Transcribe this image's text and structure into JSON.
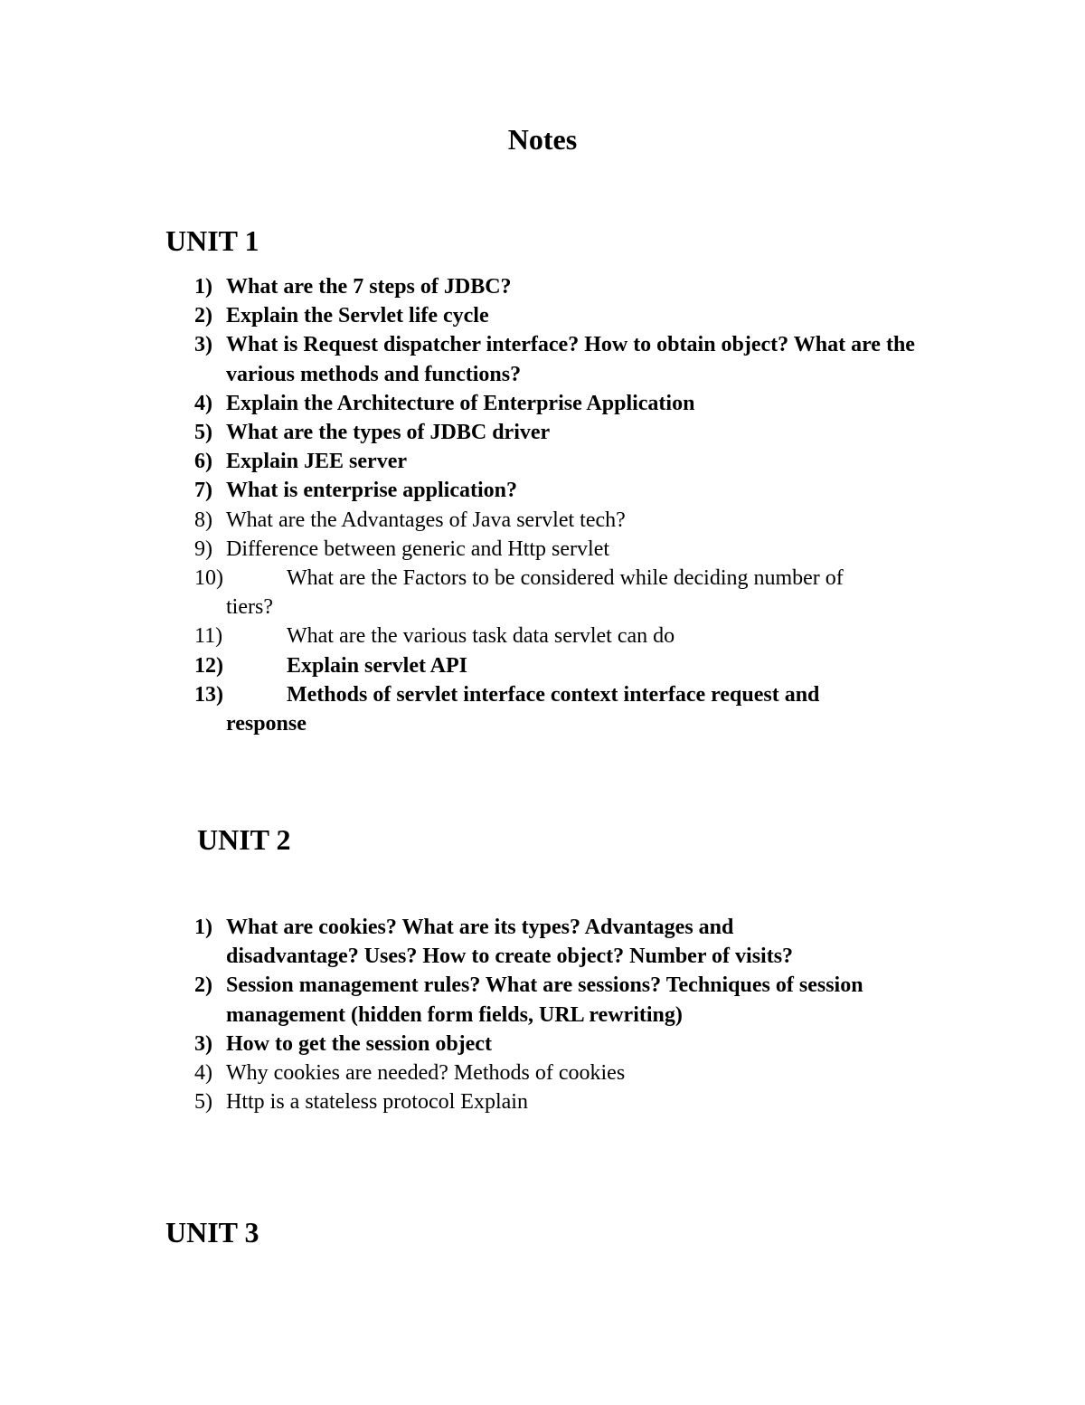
{
  "title": "Notes",
  "units": [
    {
      "heading": "UNIT 1",
      "items": [
        {
          "num": "1)",
          "text": "What are the 7 steps of JDBC?",
          "bold": true
        },
        {
          "num": "2)",
          "text": "Explain the Servlet life cycle",
          "bold": true
        },
        {
          "num": "3)",
          "text": "What is Request dispatcher interface? How to obtain object? What are the various methods and functions?",
          "bold": true
        },
        {
          "num": "4)",
          "text": "Explain the Architecture of Enterprise Application",
          "bold": true
        },
        {
          "num": "5)",
          "text": " What are the types of JDBC driver",
          "bold": true
        },
        {
          "num": "6)",
          "text": "Explain JEE server",
          "bold": true
        },
        {
          "num": "7)",
          "text": "What is enterprise application?",
          "bold": true
        },
        {
          "num": "8)",
          "text": "What are the Advantages of Java servlet tech?",
          "bold": false
        },
        {
          "num": "9)",
          "text": "Difference between generic and Http servlet",
          "bold": false
        },
        {
          "num": "10)",
          "text": "What are the Factors to be considered while deciding number of",
          "cont": "tiers?",
          "bold": false
        },
        {
          "num": "11)",
          "text": "What are the various task data servlet can do",
          "bold": false
        },
        {
          "num": "12)",
          "text": "Explain servlet API",
          "bold": true
        },
        {
          "num": "13)",
          "text": "Methods of servlet interface context interface request and",
          "cont": "response",
          "bold": true
        }
      ]
    },
    {
      "heading": "UNIT 2",
      "items": [
        {
          "num": "1)",
          "text": "What are cookies? What are its types? Advantages and",
          "cont": "disadvantage?  Uses? How to create object? Number of visits?",
          "bold": true
        },
        {
          "num": "2)",
          "text": "Session management rules? What are sessions? Techniques of session",
          "cont": "management (hidden form fields, URL rewriting)",
          "bold": true
        },
        {
          "num": "3)",
          "text": "How to get the session object",
          "bold": true
        },
        {
          "num": "4)",
          "text": "Why cookies are needed? Methods of cookies",
          "bold": false
        },
        {
          "num": "5)",
          "text": "Http is a stateless protocol Explain",
          "bold": false
        }
      ]
    },
    {
      "heading": "UNIT 3",
      "items": []
    }
  ]
}
